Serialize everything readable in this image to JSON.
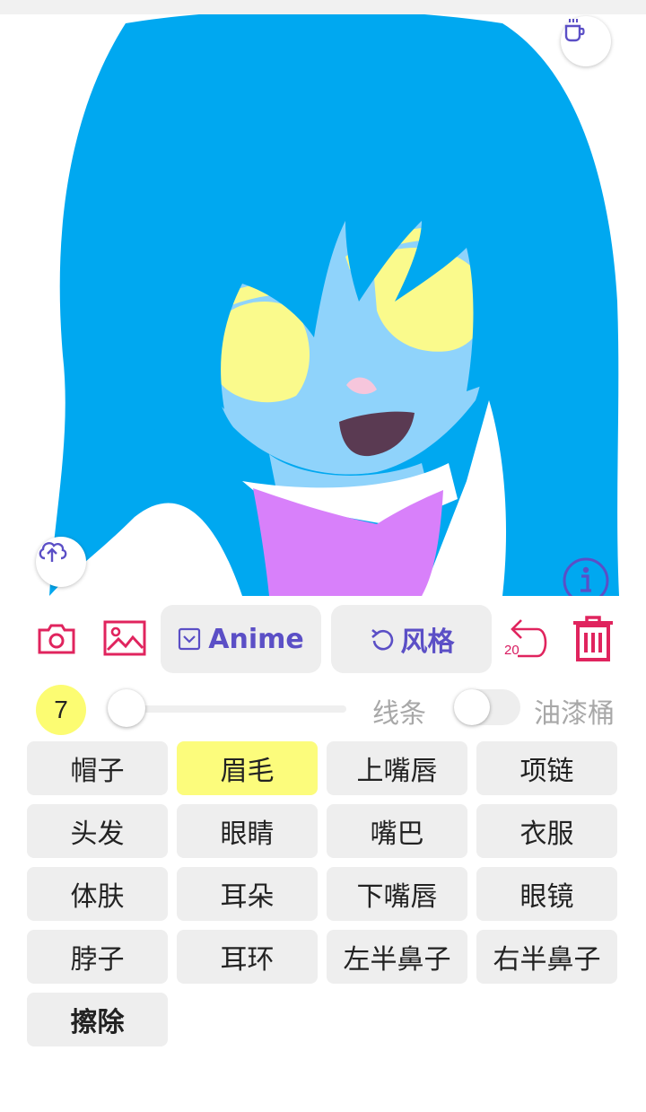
{
  "canvas": {
    "hair_color": "#00a8f0",
    "skin_color": "#8fd3fb",
    "eye_color": "#fafa8c",
    "shirt_color": "#d880fa",
    "mouth_color": "#5a3a52",
    "nose_color": "#f6c6dc"
  },
  "buttons": {
    "coffee": "coffee-icon",
    "upload": "cloud-upload-icon",
    "info": "info-icon"
  },
  "toolbar": {
    "camera": "camera-icon",
    "gallery": "image-icon",
    "anime_label": "Anime",
    "style_label": "风格",
    "undo_count": "20",
    "trash": "trash-icon"
  },
  "controls": {
    "brush_size": "7",
    "brush_slider_value": 0,
    "line_label": "线条",
    "bucket_label": "油漆桶",
    "bucket_on": false
  },
  "parts": [
    {
      "label": "帽子",
      "selected": false
    },
    {
      "label": "眉毛",
      "selected": true
    },
    {
      "label": "上嘴唇",
      "selected": false
    },
    {
      "label": "项链",
      "selected": false
    },
    {
      "label": "头发",
      "selected": false
    },
    {
      "label": "眼睛",
      "selected": false
    },
    {
      "label": "嘴巴",
      "selected": false
    },
    {
      "label": "衣服",
      "selected": false
    },
    {
      "label": "体肤",
      "selected": false
    },
    {
      "label": "耳朵",
      "selected": false
    },
    {
      "label": "下嘴唇",
      "selected": false
    },
    {
      "label": "眼镜",
      "selected": false
    },
    {
      "label": "脖子",
      "selected": false
    },
    {
      "label": "耳环",
      "selected": false
    },
    {
      "label": "左半鼻子",
      "selected": false
    },
    {
      "label": "右半鼻子",
      "selected": false
    },
    {
      "label": "擦除",
      "selected": false,
      "bold": true
    }
  ]
}
